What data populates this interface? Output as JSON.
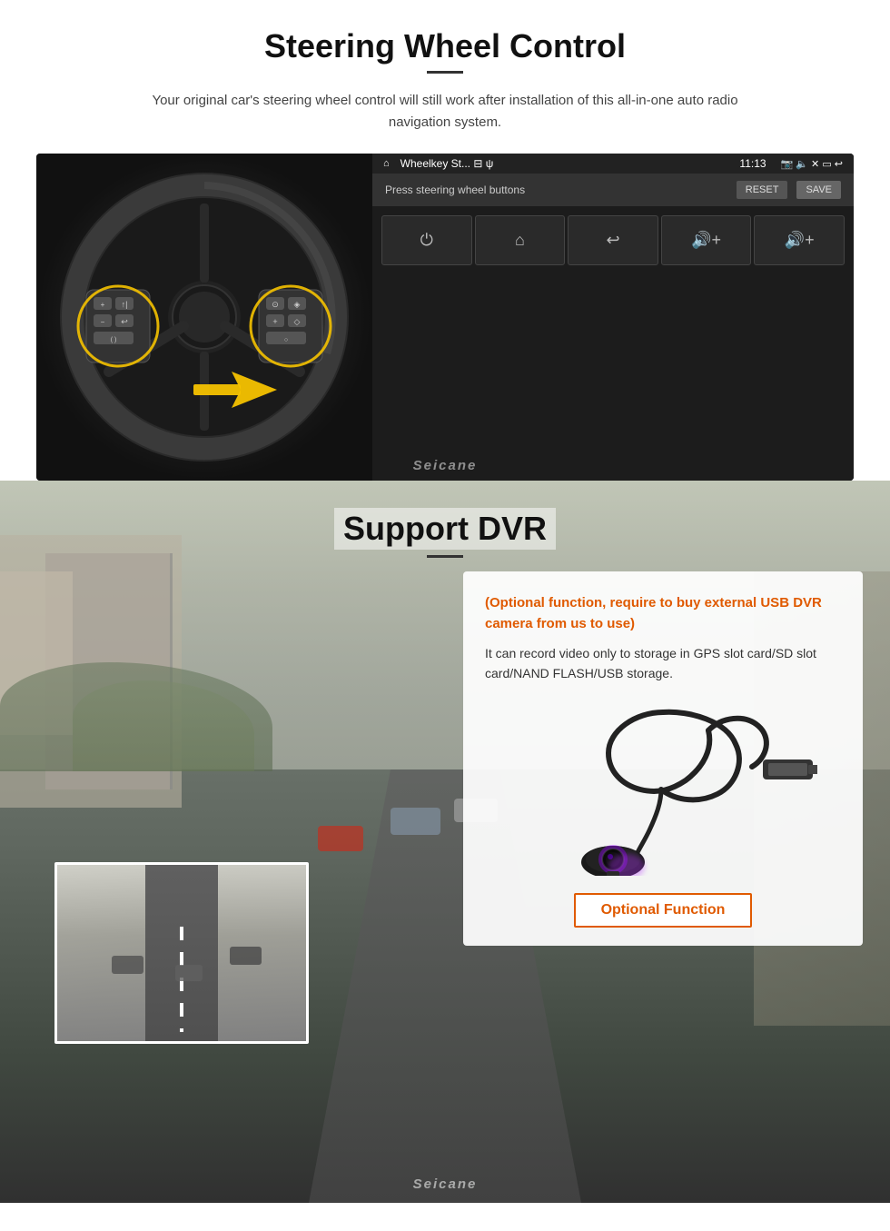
{
  "steering": {
    "title": "Steering Wheel Control",
    "subtitle": "Your original car's steering wheel control will still work after installation of this all-in-one auto radio navigation system.",
    "statusbar": {
      "app_name": "Wheelkey St... ⊟ ψ",
      "time": "11:13",
      "icons": "▼ □ ◁ ▷ ↩"
    },
    "header": {
      "label": "Press steering wheel buttons",
      "reset": "RESET",
      "save": "SAVE"
    },
    "buttons": [
      "⏻",
      "⌂",
      "↩",
      "🔊+",
      "🔊+"
    ],
    "watermark": "Seicane"
  },
  "dvr": {
    "title": "Support DVR",
    "optional_note": "(Optional function, require to buy external USB DVR camera from us to use)",
    "description": "It can record video only to storage in GPS slot card/SD slot card/NAND FLASH/USB storage.",
    "optional_badge": "Optional Function",
    "watermark": "Seicane"
  }
}
